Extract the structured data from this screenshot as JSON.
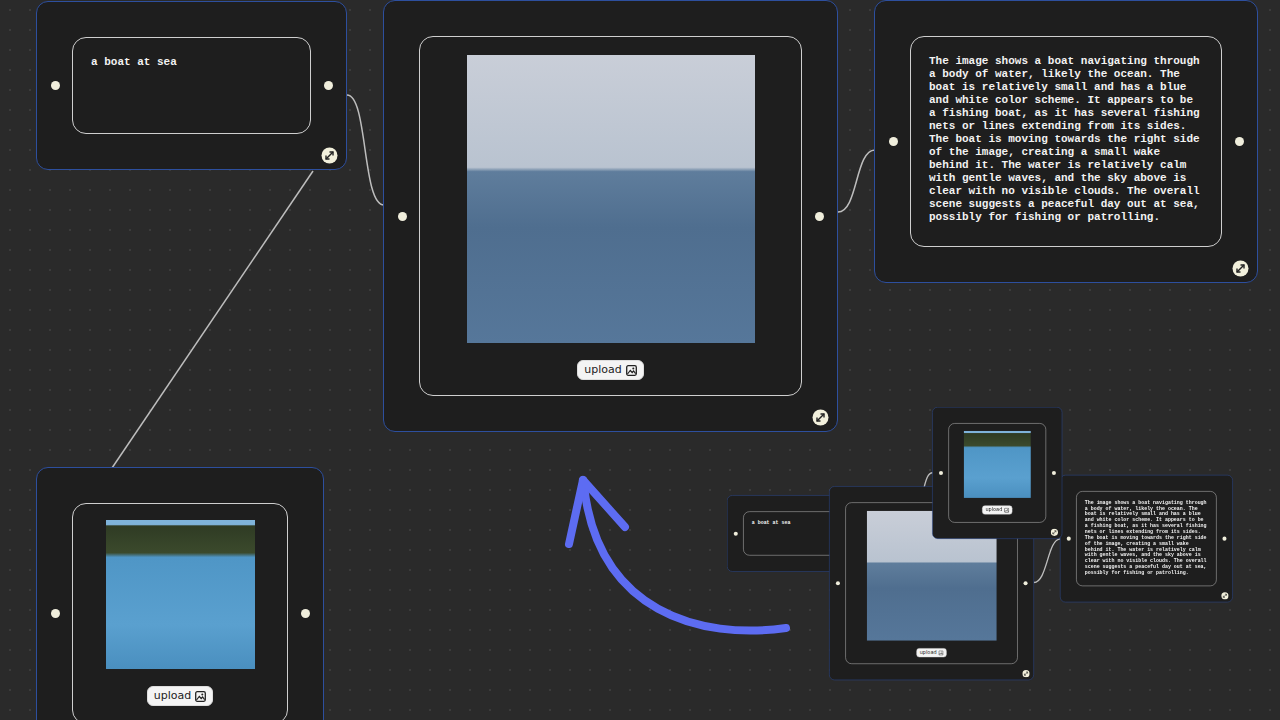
{
  "canvas": {
    "nodes": [
      {
        "kind": "text",
        "text": "a boat at sea"
      },
      {
        "kind": "image",
        "button": "upload"
      },
      {
        "kind": "text",
        "text": "The image shows a boat navigating through a body of water, likely the ocean. The boat is relatively small and has a blue and white color scheme. It appears to be a fishing boat, as it has several fishing nets or lines extending from its sides. The boat is moving towards the right side of the image, creating a small wake behind it. The water is relatively calm with gentle waves, and the sky above is clear with no visible clouds. The overall scene suggests a peaceful day out at sea, possibly for fishing or patrolling."
      },
      {
        "kind": "image",
        "button": "upload"
      }
    ]
  },
  "preview": {
    "nodes": [
      {
        "kind": "text",
        "text": "a boat at sea"
      },
      {
        "kind": "image",
        "button": "upload"
      },
      {
        "kind": "text",
        "text": "The image shows a boat navigating through a body of water, likely the ocean. The boat is relatively small and has a blue and white color scheme. It appears to be a fishing boat, as it has several fishing nets or lines extending from its sides. The boat is moving towards the right side of the image, creating a small wake behind it. The water is relatively calm with gentle waves, and the sky above is clear with no visible clouds. The overall scene suggests a peaceful day out at sea, possibly for fishing or patrolling."
      },
      {
        "kind": "image",
        "button": "upload"
      }
    ]
  }
}
